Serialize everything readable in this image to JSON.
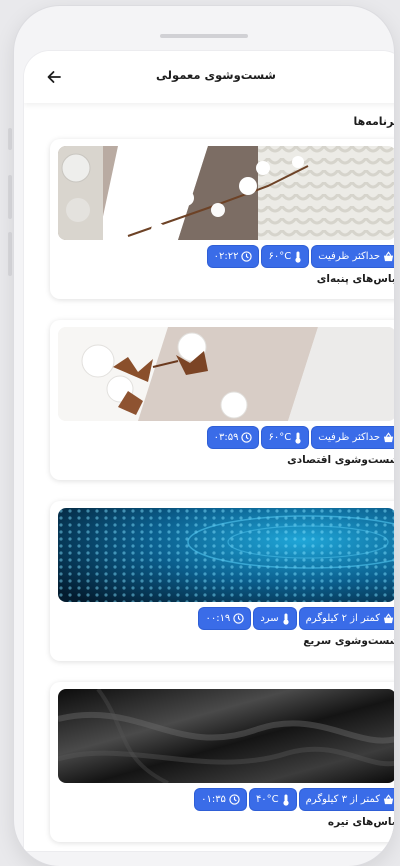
{
  "header": {
    "title": "شست‌وشوی معمولی"
  },
  "section_title": "برنامه‌ها",
  "programs": [
    {
      "title": "لباس‌های پنبه‌ای",
      "capacity": "حداکثر ظرفیت",
      "temperature": "۶۰°C",
      "duration": "۰۲:۲۲"
    },
    {
      "title": "شست‌وشوی اقتصادی",
      "capacity": "حداکثر ظرفیت",
      "temperature": "۶۰°C",
      "duration": "۰۳:۵۹"
    },
    {
      "title": "شست‌وشوی سریع",
      "capacity": "کمتر از ۲ کیلوگرم",
      "temperature": "سرد",
      "duration": "۰۰:۱۹"
    },
    {
      "title": "لباس‌های تیره",
      "capacity": "کمتر از ۳ کیلوگرم",
      "temperature": "۴۰°C",
      "duration": "۰۱:۳۵"
    }
  ],
  "colors": {
    "chip": "#3a6ce8",
    "background": "#ffffff"
  },
  "icons": {
    "back": "arrow-left-icon",
    "capacity": "basket-icon",
    "temperature": "thermometer-icon",
    "duration": "clock-icon"
  }
}
